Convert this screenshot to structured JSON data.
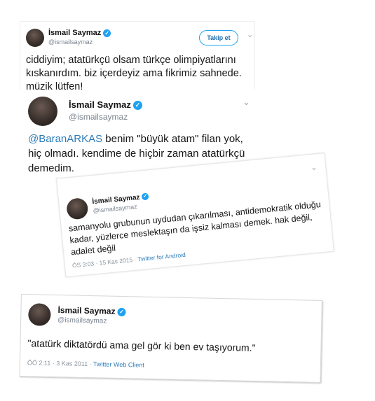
{
  "tweet1": {
    "name": "İsmail Saymaz",
    "handle": "@ismailsaymaz",
    "follow_label": "Takip et",
    "text": "ciddiyim; atatürkçü olsam türkçe olimpiyatlarını kıskanırdım. biz içerdeyiz ama fikrimiz sahnede. müzik lütfen!"
  },
  "tweet2": {
    "name": "İsmail Saymaz",
    "handle": "@ismailsaymaz",
    "mention": "@BaranARKAS",
    "text": " benim \"büyük atam\" filan yok, hiç olmadı. kendime de hiçbir zaman atatürkçü demedim."
  },
  "tweet3": {
    "name": "İsmail Saymaz",
    "handle": "@ismailsaymaz",
    "text": "samanyolu grubunun uydudan çıkarılması, antidemokratik olduğu kadar, yüzlerce meslektaşın da işsiz kalması demek. hak değil, adalet değil",
    "time": "ÖS 3:03 · 15 Kas 2015 · ",
    "source": "Twitter for Android"
  },
  "tweet4": {
    "name": "İsmail Saymaz",
    "handle": "@ismailsaymaz",
    "text": "\"atatürk diktatördü ama gel gör ki ben ev taşıyorum.\"",
    "time": "ÖÖ 2:11 · 3 Kas 2011 · ",
    "source": "Twitter Web Client"
  },
  "icons": {
    "verified": "verified-badge-icon",
    "chevron": "chevron-down-icon"
  },
  "colors": {
    "link": "#2b7bb9",
    "verified": "#1da1f2",
    "handle": "#7a8590"
  }
}
